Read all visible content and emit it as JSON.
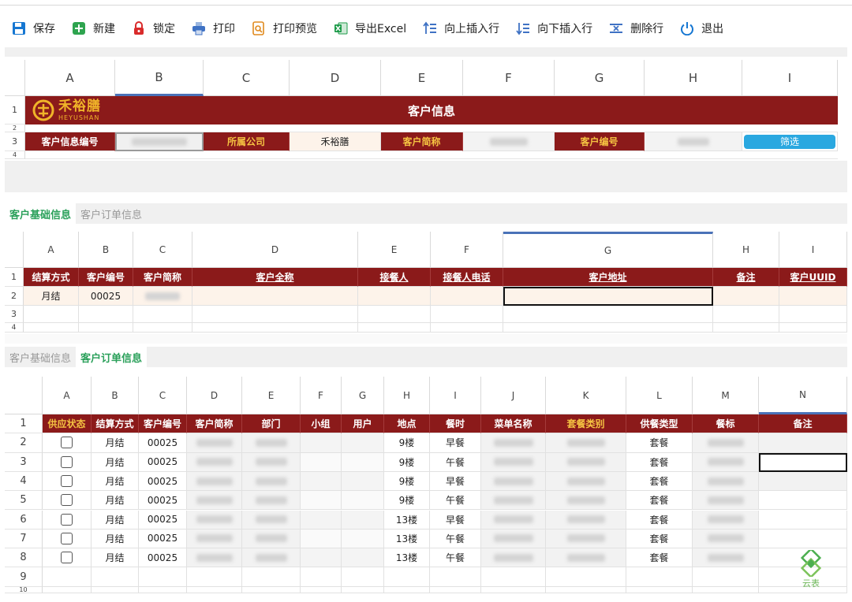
{
  "toolbar": {
    "buttons": [
      {
        "label": "保存",
        "icon": "save-icon",
        "color": "#1677d2"
      },
      {
        "label": "新建",
        "icon": "new-icon",
        "color": "#2ea44f"
      },
      {
        "label": "锁定",
        "icon": "lock-icon",
        "color": "#d92b2b"
      },
      {
        "label": "打印",
        "icon": "print-icon",
        "color": "#3f72c4"
      },
      {
        "label": "打印预览",
        "icon": "print-preview-icon",
        "color": "#e08a1e"
      },
      {
        "label": "导出Excel",
        "icon": "excel-icon",
        "color": "#1e9b4a"
      },
      {
        "label": "向上插入行",
        "icon": "insert-row-above-icon",
        "color": "#3f72c4"
      },
      {
        "label": "向下插入行",
        "icon": "insert-row-below-icon",
        "color": "#3f72c4"
      },
      {
        "label": "删除行",
        "icon": "delete-row-icon",
        "color": "#3f72c4"
      },
      {
        "label": "退出",
        "icon": "power-icon",
        "color": "#1677d2"
      }
    ]
  },
  "sheet1": {
    "columns": [
      "A",
      "B",
      "C",
      "D",
      "E",
      "F",
      "G",
      "H",
      "I"
    ],
    "rows": [
      "1",
      "2",
      "3",
      "4"
    ],
    "logo": {
      "cn": "禾裕膳",
      "en": "HEYUSHAN",
      "brand_color": "#f0b429"
    },
    "title": "客户信息",
    "row3": {
      "label1": "客户信息编号",
      "label2": "所属公司",
      "value2": "禾裕膳",
      "label3": "客户简称",
      "label4": "客户编号",
      "filter_button": "筛选"
    }
  },
  "tabs1": {
    "active": "客户基础信息",
    "inactive": "客户订单信息"
  },
  "sheet2": {
    "columns": [
      "A",
      "B",
      "C",
      "D",
      "E",
      "F",
      "G",
      "H",
      "I"
    ],
    "rows": [
      "1",
      "2",
      "3",
      "4"
    ],
    "headers": [
      "结算方式",
      "客户编号",
      "客户简称",
      "客户全称",
      "接餐人",
      "接餐人电话",
      "客户地址",
      "备注",
      "客户UUID"
    ],
    "data": [
      {
        "settle": "月结",
        "code": "00025"
      }
    ]
  },
  "tabs2": {
    "inactive": "客户基础信息",
    "active": "客户订单信息"
  },
  "sheet3": {
    "columns": [
      "A",
      "B",
      "C",
      "D",
      "E",
      "F",
      "G",
      "H",
      "I",
      "J",
      "K",
      "L",
      "M",
      "N"
    ],
    "rows": [
      "1",
      "2",
      "3",
      "4",
      "5",
      "6",
      "7",
      "8",
      "9",
      "10"
    ],
    "headers": [
      "供应状态",
      "结算方式",
      "客户编号",
      "客户简称",
      "部门",
      "小组",
      "用户",
      "地点",
      "餐时",
      "菜单名称",
      "套餐类别",
      "供餐类型",
      "餐标",
      "备注"
    ],
    "data": [
      {
        "settle": "月结",
        "code": "00025",
        "place": "9楼",
        "meal": "早餐",
        "type": "套餐"
      },
      {
        "settle": "月结",
        "code": "00025",
        "place": "9楼",
        "meal": "午餐",
        "type": "套餐"
      },
      {
        "settle": "月结",
        "code": "00025",
        "place": "9楼",
        "meal": "早餐",
        "type": "套餐"
      },
      {
        "settle": "月结",
        "code": "00025",
        "place": "9楼",
        "meal": "午餐",
        "type": "套餐"
      },
      {
        "settle": "月结",
        "code": "00025",
        "place": "13楼",
        "meal": "早餐",
        "type": "套餐"
      },
      {
        "settle": "月结",
        "code": "00025",
        "place": "13楼",
        "meal": "午餐",
        "type": "套餐"
      },
      {
        "settle": "月结",
        "code": "00025",
        "place": "13楼",
        "meal": "午餐",
        "type": "套餐"
      }
    ]
  },
  "watermark": {
    "text": "云表"
  }
}
